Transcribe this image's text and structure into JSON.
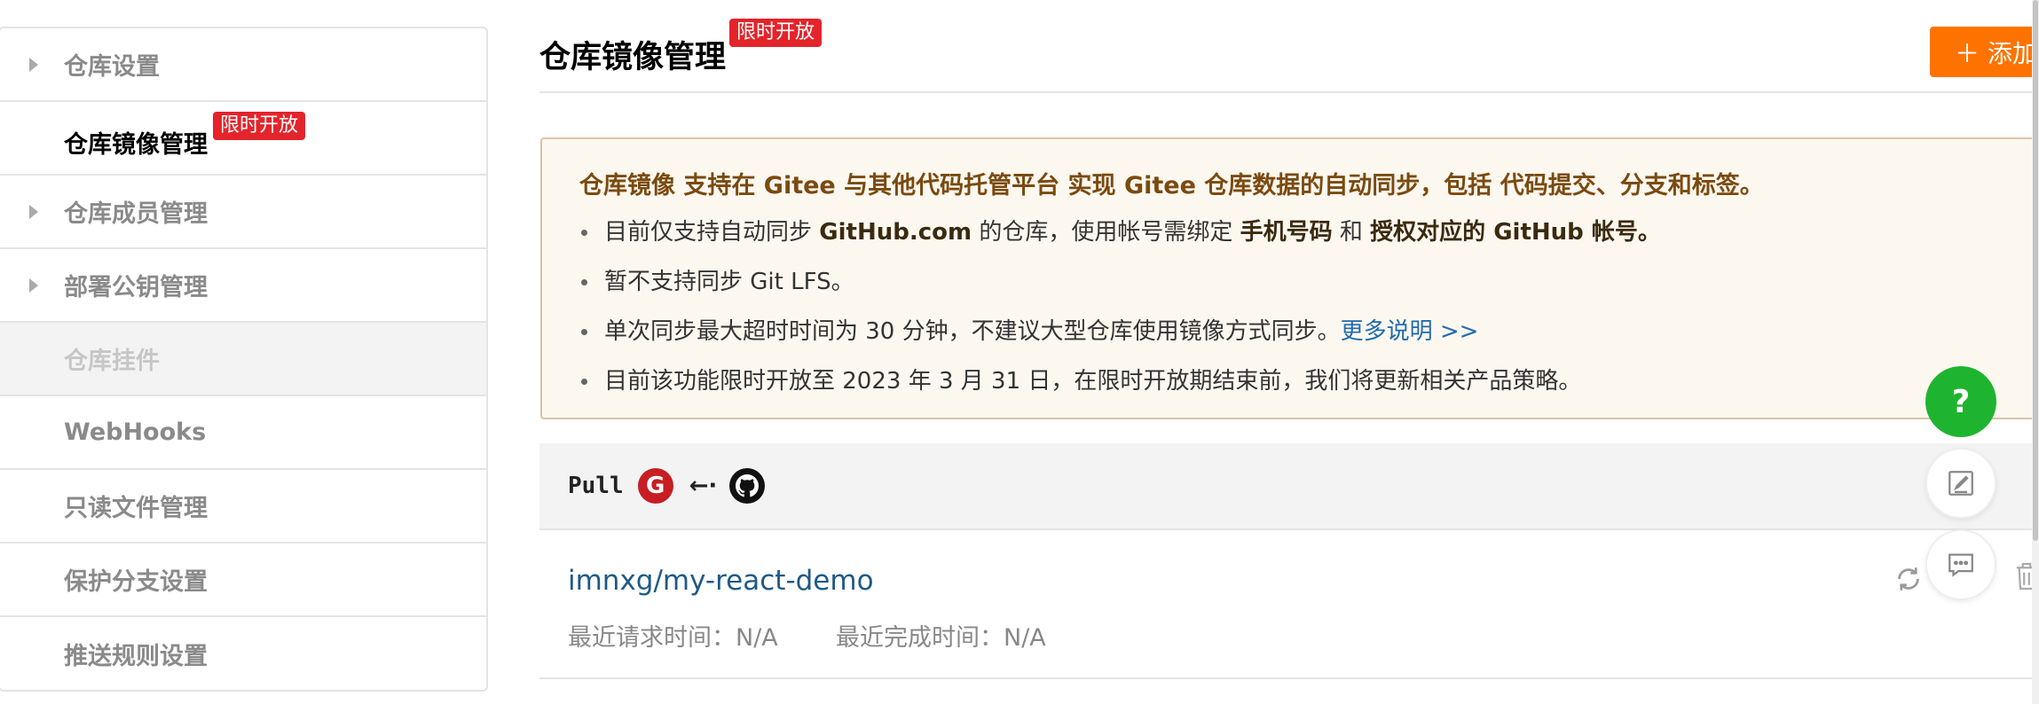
{
  "sidebar": {
    "items": [
      {
        "label": "仓库设置"
      },
      {
        "label": "仓库镜像管理",
        "badge": "限时开放"
      },
      {
        "label": "仓库成员管理"
      },
      {
        "label": "部署公钥管理"
      },
      {
        "label": "仓库挂件"
      },
      {
        "label": "WebHooks"
      },
      {
        "label": "只读文件管理"
      },
      {
        "label": "保护分支设置"
      },
      {
        "label": "推送规则设置"
      }
    ]
  },
  "header": {
    "title": "仓库镜像管理",
    "badge": "限时开放",
    "add_button": "＋ 添加"
  },
  "notice": {
    "lead": "仓库镜像 支持在 Gitee 与其他代码托管平台 实现 Gitee 仓库数据的自动同步，包括 代码提交、分支和标签。",
    "item1_a": "目前仅支持自动同步 ",
    "item1_b": "GitHub.com",
    "item1_c": " 的仓库，使用帐号需绑定 ",
    "item1_d": "手机号码",
    "item1_e": " 和 ",
    "item1_f": "授权对应的 GitHub 帐号",
    "item1_g": "。",
    "item2": "暂不支持同步 Git LFS。",
    "item3": "单次同步最大超时时间为 30 分钟，不建议大型仓库使用镜像方式同步。",
    "item3_link": "更多说明 >>",
    "item4": "目前该功能限时开放至 2023 年 3 月 31 日，在限时开放期结束前，我们将更新相关产品策略。"
  },
  "mirror": {
    "direction": "Pull",
    "gitee_glyph": "G",
    "arrow": "←·",
    "repo": "imnxg/my-react-demo",
    "last_request": "最近请求时间：N/A",
    "last_complete": "最近完成时间：N/A"
  },
  "fab": {
    "help": "?"
  },
  "colors": {
    "badge": "#e3242b",
    "accent": "#fe7300",
    "help": "#1fb42f",
    "link": "#1f6ab0"
  },
  "icons": [
    "gitee-icon",
    "github-icon",
    "sync-icon",
    "trash-icon",
    "edit-icon",
    "chat-icon"
  ]
}
